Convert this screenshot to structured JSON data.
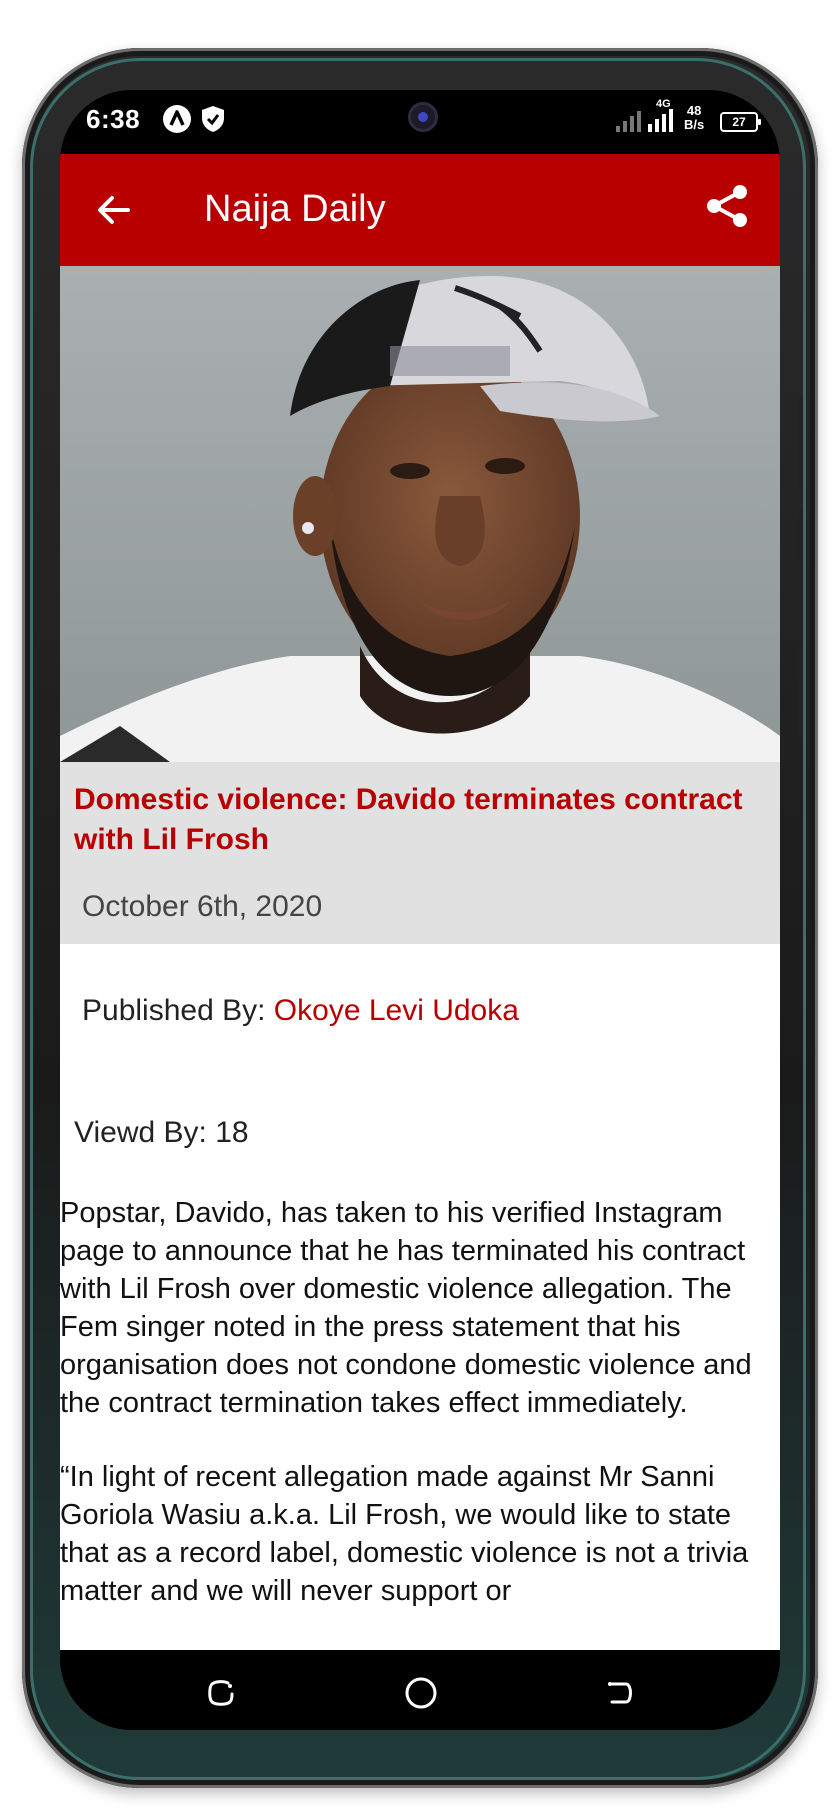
{
  "status_bar": {
    "time": "6:38",
    "network_label": "4G",
    "net_speed_value": "48",
    "net_speed_unit": "B/s",
    "battery_level": "27"
  },
  "app_bar": {
    "title": "Naija Daily",
    "back_icon": "arrow-left-icon",
    "share_icon": "share-icon"
  },
  "article": {
    "headline": "Domestic violence: Davido terminates contract with Lil Frosh",
    "date": "October 6th, 2020",
    "published_label": "Published By:",
    "author": "Okoye Levi Udoka",
    "viewed_label": "Viewd By:",
    "view_count": "18",
    "paragraphs": [
      "Popstar, Davido, has taken to his verified Instagram page to announce that he has terminated his contract with Lil Frosh over domestic violence allegation. The Fem singer noted in the press statement that his organisation does not condone domestic violence and the contract termination takes effect immediately.",
      "“In light of recent allegation made against Mr Sanni Goriola Wasiu a.k.a. Lil Frosh, we would like to state that as a record label, domestic violence is not a trivia matter and we will never support or"
    ]
  },
  "colors": {
    "brand_red": "#b80000",
    "headline_bg": "#e1e1e1"
  },
  "nav_bar": {
    "recents_icon": "recents-icon",
    "home_icon": "home-circle-icon",
    "back_icon": "back-nav-icon"
  }
}
